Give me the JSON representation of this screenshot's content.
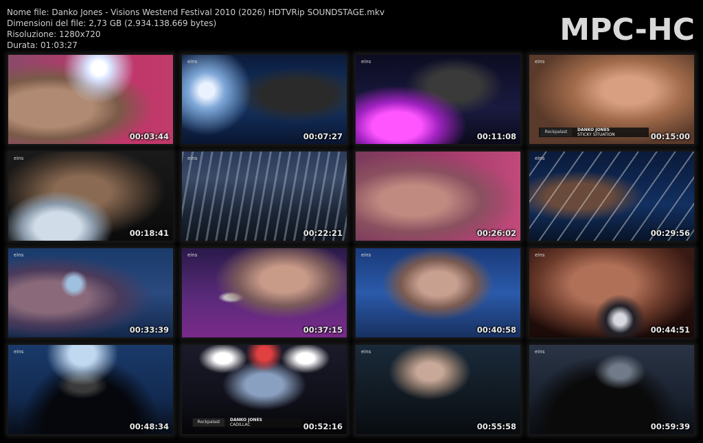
{
  "file_info": {
    "name": "Nome file: Danko Jones - Visions Westend Festival 2010 (2026) HDTVRip SOUNDSTAGE.mkv",
    "size": "Dimensioni del file: 2,73 GB (2.934.138.669 bytes)",
    "resolution": "Risoluzione: 1280x720",
    "duration": "Durata: 01:03:27"
  },
  "brand": "MPC-HC",
  "thumbnails": [
    {
      "time": "00:03:44",
      "scene": "face-closeup-pink"
    },
    {
      "time": "00:07:27",
      "scene": "drummer-blue"
    },
    {
      "time": "00:11:08",
      "scene": "drummer-purple-kit"
    },
    {
      "time": "00:15:00",
      "scene": "face-closeup-skin",
      "lower_third": {
        "title": "DANKO JONES",
        "subtitle": "STICKY SITUATION",
        "badge": "Rockpalast"
      }
    },
    {
      "time": "00:18:41",
      "scene": "singer-bottle"
    },
    {
      "time": "00:22:21",
      "scene": "crowd-hands"
    },
    {
      "time": "00:26:02",
      "scene": "skin-closeup-pink"
    },
    {
      "time": "00:29:56",
      "scene": "guitar-neck"
    },
    {
      "time": "00:33:39",
      "scene": "microphone-blur-blue"
    },
    {
      "time": "00:37:15",
      "scene": "singer-mic-purple"
    },
    {
      "time": "00:40:58",
      "scene": "singer-mic-blue"
    },
    {
      "time": "00:44:51",
      "scene": "face-mic-red"
    },
    {
      "time": "00:48:34",
      "scene": "stage-guitarist-crowd"
    },
    {
      "time": "00:52:16",
      "scene": "stage-lights-crowd",
      "lower_third": {
        "title": "DANKO JONES",
        "subtitle": "CADILLAC",
        "badge": "Rockpalast"
      }
    },
    {
      "time": "00:55:58",
      "scene": "drummer-dark"
    },
    {
      "time": "00:59:39",
      "scene": "stage-dark"
    }
  ],
  "channel_logo": "eins"
}
